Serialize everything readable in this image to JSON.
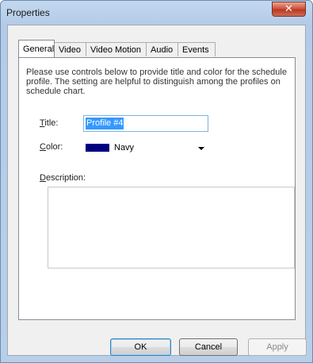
{
  "window": {
    "title": "Properties",
    "close_glyph": "✕"
  },
  "tabs": [
    {
      "label": "General",
      "active": true
    },
    {
      "label": "Video",
      "active": false
    },
    {
      "label": "Video Motion",
      "active": false
    },
    {
      "label": "Audio",
      "active": false
    },
    {
      "label": "Events",
      "active": false
    }
  ],
  "general": {
    "intro": "Please use controls below to provide title and color for the schedule profile. The setting are helpful to distinguish among the profiles on schedule chart.",
    "title_label_accel": "T",
    "title_label_rest": "itle:",
    "title_value": "Profile #4",
    "color_label_accel": "C",
    "color_label_rest": "olor:",
    "color_value": "Navy",
    "color_swatch": "#000080",
    "description_label_accel": "D",
    "description_label_rest": "escription:",
    "description_value": ""
  },
  "buttons": {
    "ok": "OK",
    "cancel": "Cancel",
    "apply": "Apply"
  },
  "colors": {
    "frame": "#b8cfe9",
    "selection": "#3399ff",
    "close": "#c4432b"
  }
}
